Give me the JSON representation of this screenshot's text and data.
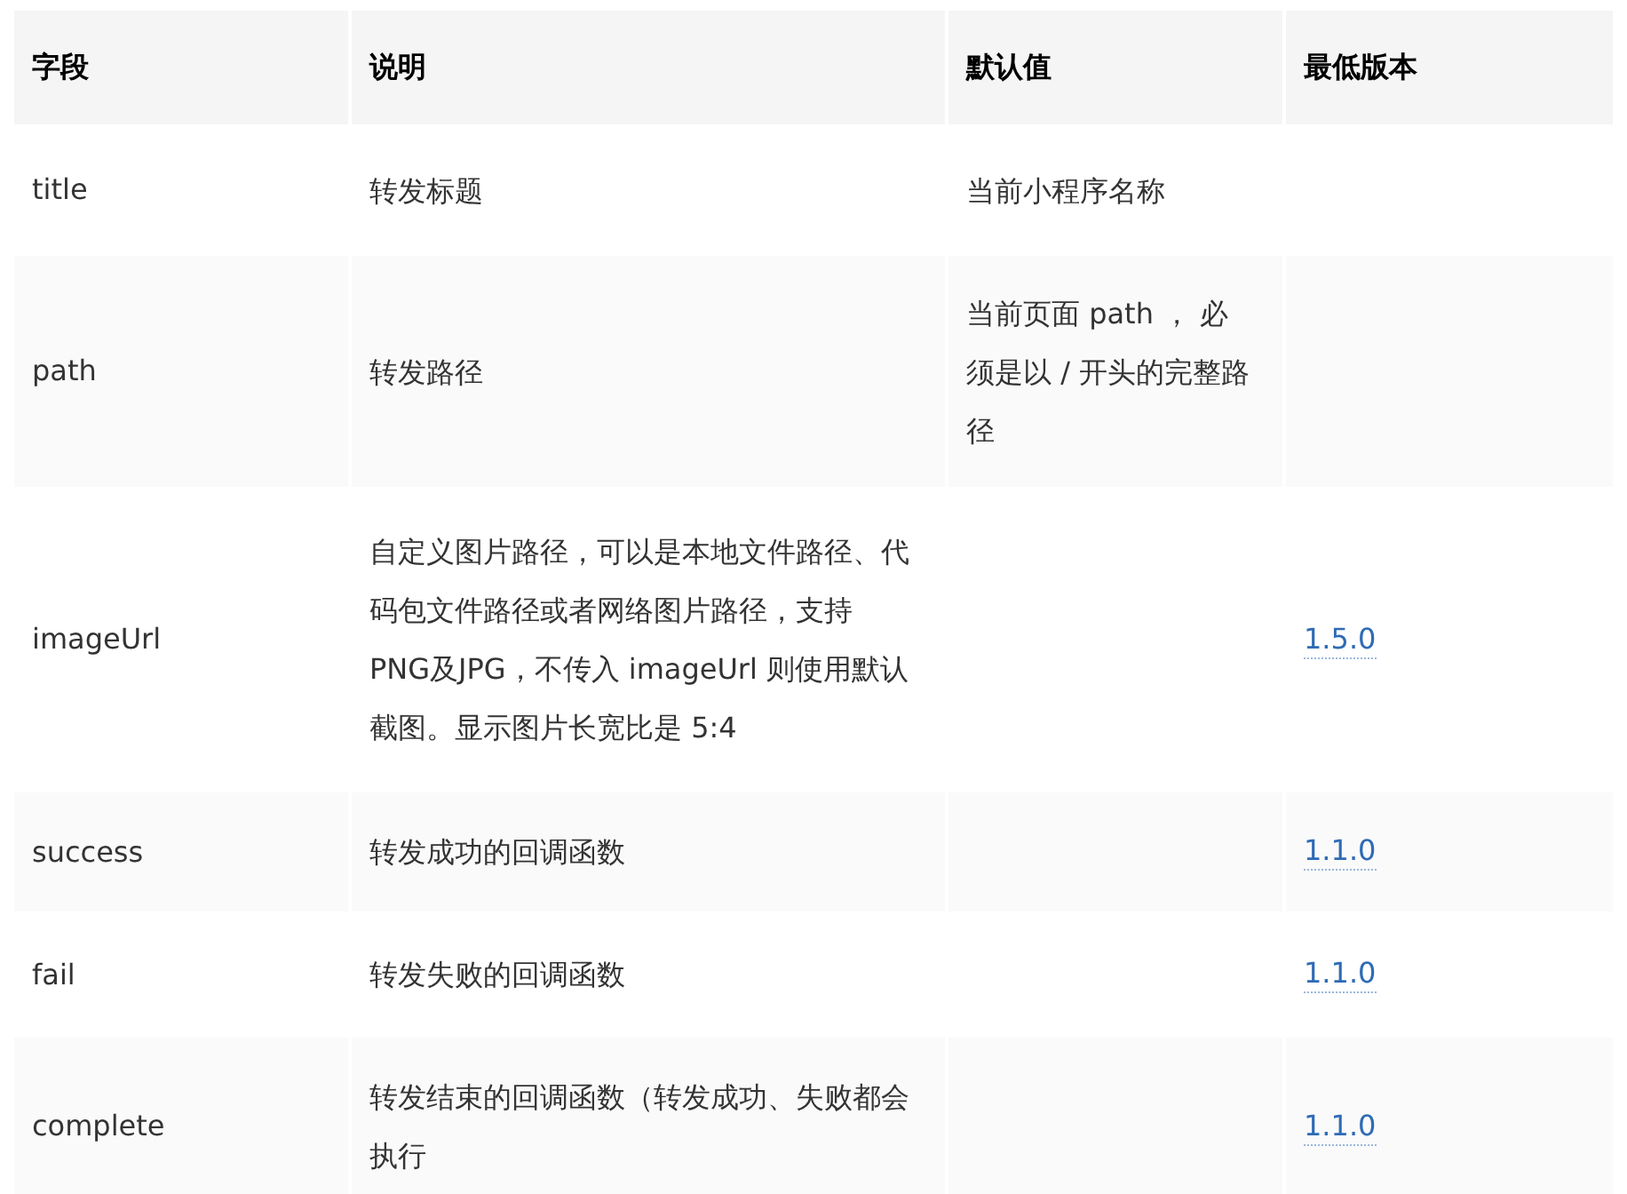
{
  "table": {
    "columns": [
      "字段",
      "说明",
      "默认值",
      "最低版本"
    ],
    "rows": [
      {
        "field": "title",
        "description": "转发标题",
        "default": "当前小程序名称"
      },
      {
        "field": "path",
        "description": "转发路径",
        "default": "当前页面 path ， 必须是以 / 开头的完整路径"
      },
      {
        "field": "imageUrl",
        "description": "自定义图片路径，可以是本地文件路径、代码包文件路径或者网络图片路径，支持PNG及JPG，不传入 imageUrl 则使用默认截图。显示图片长宽比是 5:4",
        "version": "1.5.0"
      },
      {
        "field": "success",
        "description": "转发成功的回调函数",
        "version": "1.1.0"
      },
      {
        "field": "fail",
        "description": "转发失败的回调函数",
        "version": "1.1.0"
      },
      {
        "field": "complete",
        "description": "转发结束的回调函数（转发成功、失败都会执行",
        "version": "1.1.0"
      }
    ]
  }
}
